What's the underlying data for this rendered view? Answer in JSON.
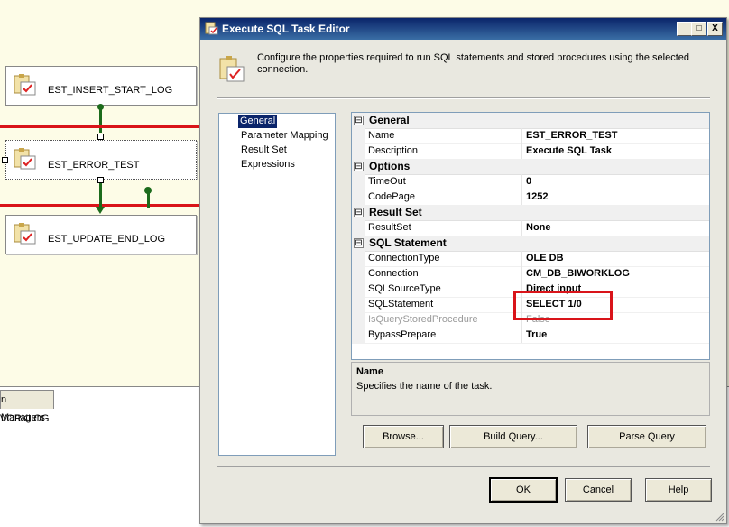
{
  "designer": {
    "tasks": [
      {
        "label": "EST_INSERT_START_LOG"
      },
      {
        "label": "EST_ERROR_TEST"
      },
      {
        "label": "EST_UPDATE_END_LOG"
      }
    ],
    "connection_managers_tab": "n Managers",
    "connection_item": "VORKLOG"
  },
  "dialog": {
    "title": "Execute SQL Task Editor",
    "window_buttons": {
      "minimize": "_",
      "maximize": "□",
      "close": "X"
    },
    "description": "Configure the properties required to run SQL statements and stored procedures using the selected connection.",
    "nav": [
      "General",
      "Parameter Mapping",
      "Result Set",
      "Expressions"
    ],
    "selected_nav": "General",
    "grid": {
      "categories": [
        {
          "name": "General",
          "expander": "⊟",
          "rows": [
            {
              "name": "Name",
              "value": "EST_ERROR_TEST"
            },
            {
              "name": "Description",
              "value": "Execute SQL Task"
            }
          ]
        },
        {
          "name": "Options",
          "expander": "⊟",
          "rows": [
            {
              "name": "TimeOut",
              "value": "0"
            },
            {
              "name": "CodePage",
              "value": "1252"
            }
          ]
        },
        {
          "name": "Result Set",
          "expander": "⊟",
          "rows": [
            {
              "name": "ResultSet",
              "value": "None"
            }
          ]
        },
        {
          "name": "SQL Statement",
          "expander": "⊟",
          "rows": [
            {
              "name": "ConnectionType",
              "value": "OLE DB"
            },
            {
              "name": "Connection",
              "value": "CM_DB_BIWORKLOG"
            },
            {
              "name": "SQLSourceType",
              "value": "Direct input"
            },
            {
              "name": "SQLStatement",
              "value": "SELECT 1/0"
            },
            {
              "name": "IsQueryStoredProcedure",
              "value": "False",
              "disabled": true
            },
            {
              "name": "BypassPrepare",
              "value": "True"
            }
          ]
        }
      ]
    },
    "help": {
      "title": "Name",
      "text": "Specifies the name of the task."
    },
    "buttons": {
      "browse": "Browse...",
      "build_query": "Build Query...",
      "parse_query": "Parse Query",
      "ok": "OK",
      "cancel": "Cancel",
      "help": "Help"
    }
  },
  "colors": {
    "highlight_red": "#d9141a",
    "title_blue": "#0a246a",
    "connector_green": "#1c6b1c"
  }
}
